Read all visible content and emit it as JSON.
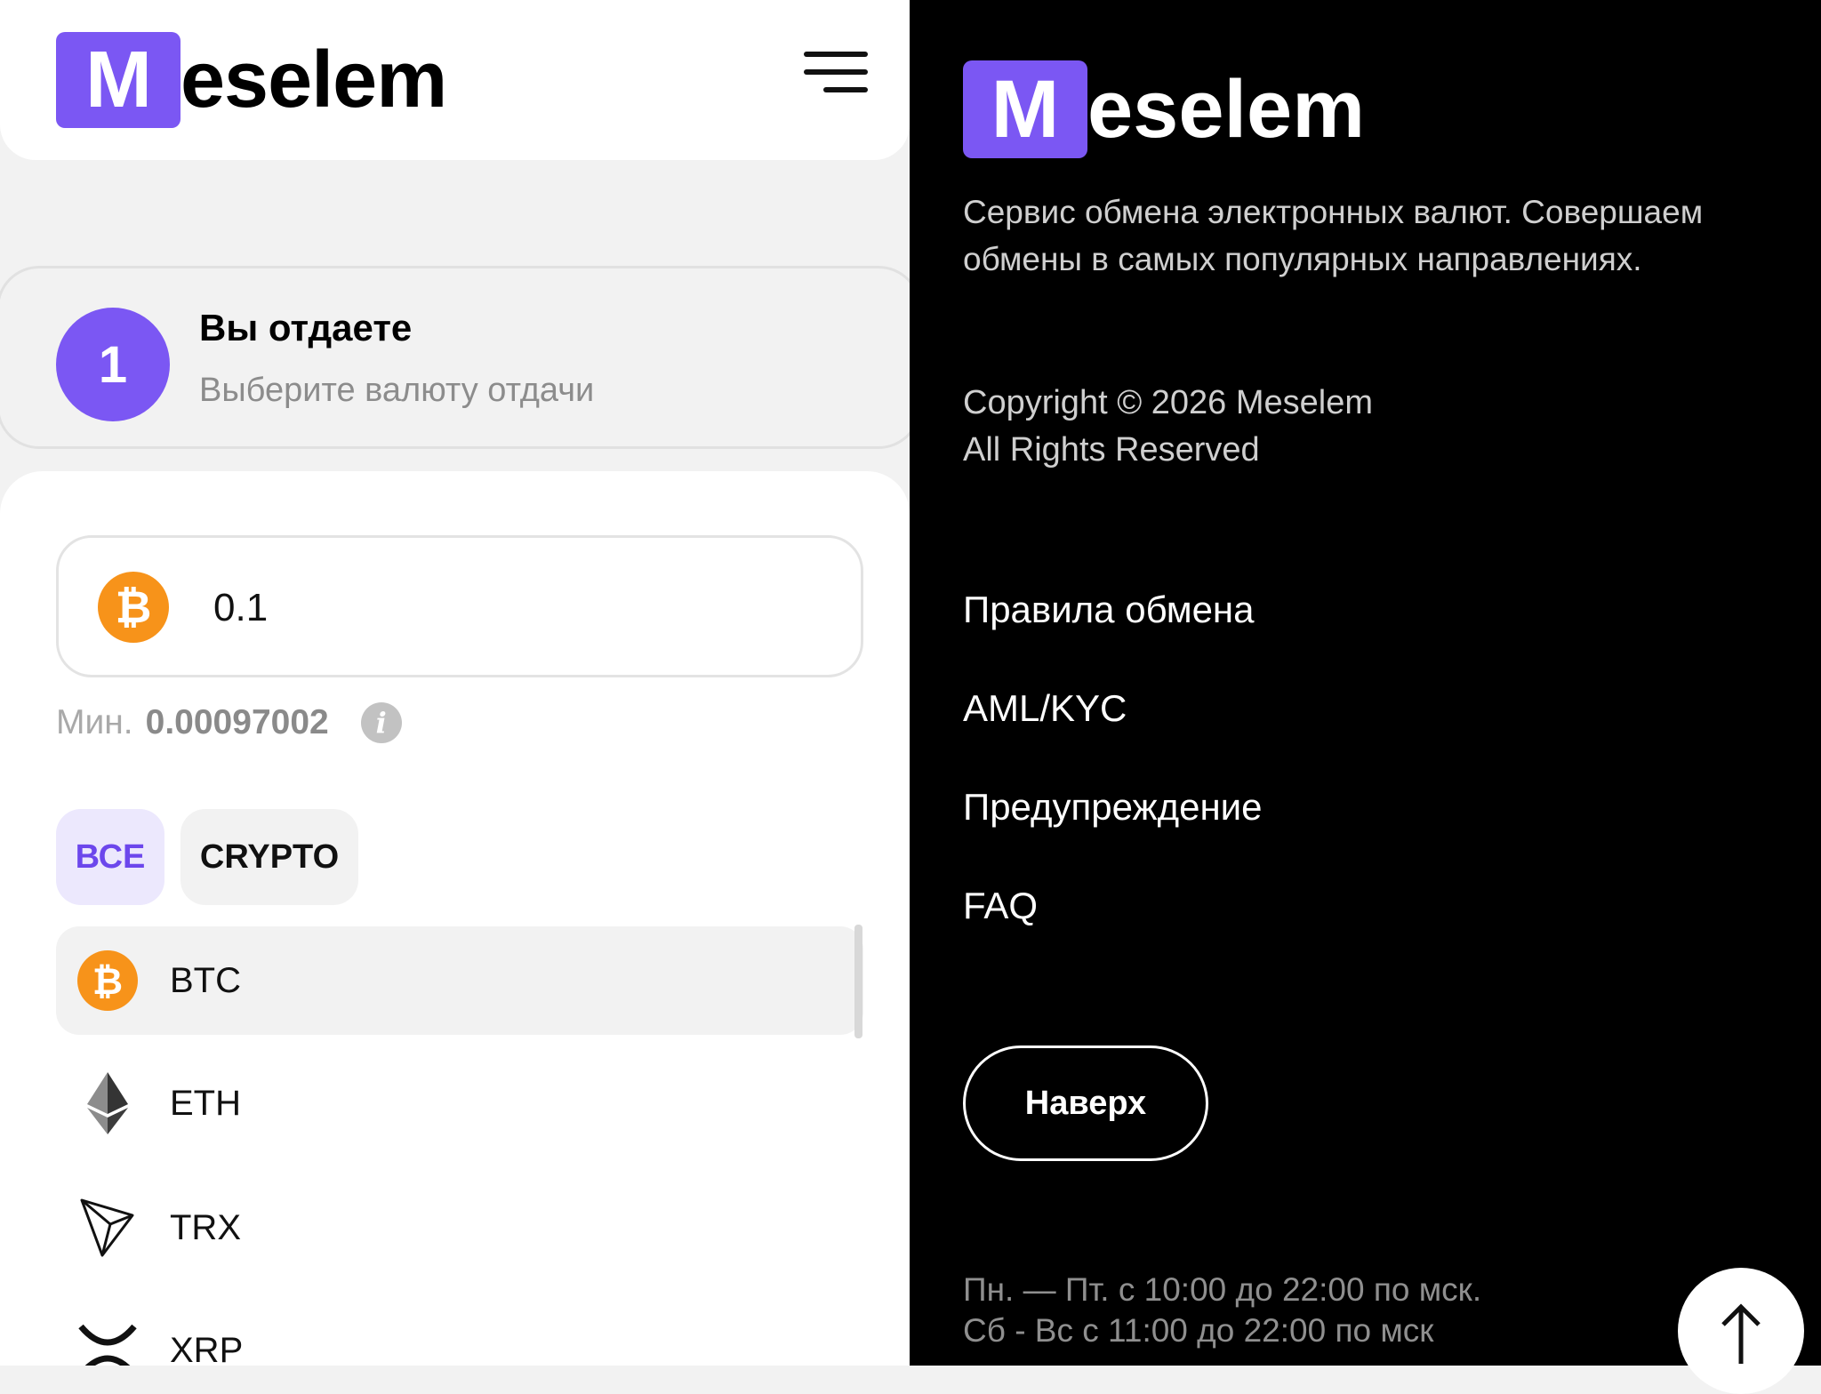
{
  "brand": {
    "logo_letter": "M",
    "logo_rest": "eselem",
    "accent": "#7b57f3"
  },
  "exchange": {
    "step_number": "1",
    "step_title": "Вы отдаете",
    "step_subtitle": "Выберите валюту отдачи",
    "amount_value": "0.1",
    "min_label": "Мин.",
    "min_value": "0.00097002",
    "filters": [
      "ВСЕ",
      "CRYPTO"
    ],
    "currencies": [
      "BTC",
      "ETH",
      "TRX",
      "XRP"
    ],
    "selected_currency": "BTC"
  },
  "footer": {
    "description": "Сервис обмена электронных валют. Совершаем обмены в самых популярных направлениях.",
    "copyright_line1": "Copyright © 2026 Meselem",
    "copyright_line2": "All Rights Reserved",
    "links": [
      "Правила обмена",
      "AML/KYC",
      "Предупреждение",
      "FAQ"
    ],
    "top_button": "Наверх",
    "hours_line1": "Пн. — Пт. с 10:00 до 22:00 по мск.",
    "hours_line2": "Сб - Вс с 11:00 до 22:00 по мск"
  },
  "icons": [
    "menu-icon",
    "bitcoin-icon",
    "info-icon",
    "ethereum-icon",
    "tron-icon",
    "xrp-icon",
    "arrow-up-icon"
  ]
}
